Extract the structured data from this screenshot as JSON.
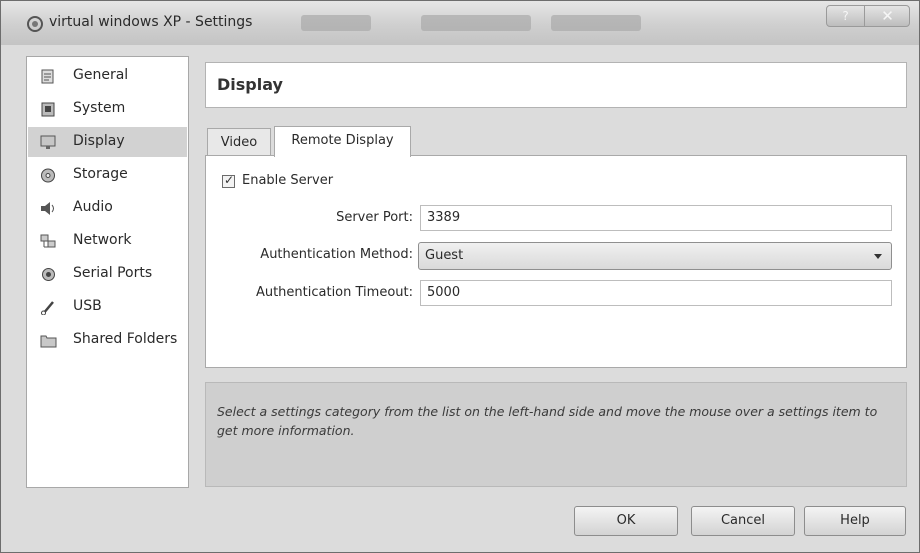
{
  "window": {
    "title": "virtual windows XP - Settings",
    "help_button": "?",
    "close_button": "✕"
  },
  "sidebar": {
    "items": [
      {
        "label": "General",
        "icon": "general-icon"
      },
      {
        "label": "System",
        "icon": "system-icon"
      },
      {
        "label": "Display",
        "icon": "display-icon",
        "selected": true
      },
      {
        "label": "Storage",
        "icon": "storage-icon"
      },
      {
        "label": "Audio",
        "icon": "audio-icon"
      },
      {
        "label": "Network",
        "icon": "network-icon"
      },
      {
        "label": "Serial Ports",
        "icon": "serial-ports-icon"
      },
      {
        "label": "USB",
        "icon": "usb-icon"
      },
      {
        "label": "Shared Folders",
        "icon": "shared-folders-icon"
      }
    ]
  },
  "header": {
    "title": "Display"
  },
  "tabs": [
    {
      "label": "Video",
      "active": false
    },
    {
      "label": "Remote Display",
      "active": true
    }
  ],
  "remote_display": {
    "enable_server_label": "Enable Server",
    "enable_server_checked": true,
    "server_port_label": "Server Port:",
    "server_port_value": "3389",
    "auth_method_label": "Authentication Method:",
    "auth_method_value": "Guest",
    "auth_timeout_label": "Authentication Timeout:",
    "auth_timeout_value": "5000"
  },
  "info": {
    "text": "Select a settings category from the list on the left-hand side and move the mouse over a settings item to get more information."
  },
  "buttons": {
    "ok": "OK",
    "cancel": "Cancel",
    "help": "Help"
  }
}
